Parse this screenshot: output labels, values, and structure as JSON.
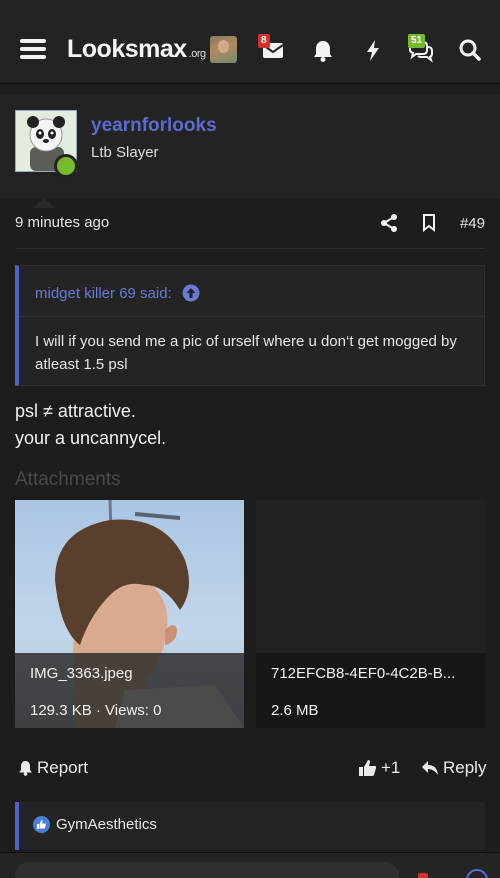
{
  "header": {
    "logo_text": "Looksmax",
    "logo_suffix": ".org",
    "inbox_badge": "8",
    "conversations_badge": "51",
    "icons": [
      "menu-icon",
      "user-avatar",
      "inbox-icon",
      "bell-icon",
      "bolt-icon",
      "chat-bubbles-icon",
      "search-icon"
    ]
  },
  "post": {
    "username": "yearnforlooks",
    "user_title": "Ltb Slayer",
    "time": "9 minutes ago",
    "number": "#49",
    "quote": {
      "author_label": "midget killer 69 said:",
      "text": "I will if you send me a pic of urself where u don‘t get mogged by atleast 1.5 psl"
    },
    "body_line1": "psl ≠ attractive.",
    "body_line2": "your a uncannycel.",
    "attachments_title": "Attachments",
    "attachments": [
      {
        "name": "IMG_3363.jpeg",
        "meta": "129.3 KB · Views: 0"
      },
      {
        "name": "712EFCB8-4EF0-4C2B-B...",
        "meta": "2.6 MB"
      }
    ],
    "actions": {
      "report": "Report",
      "like": "+1",
      "reply": "Reply"
    },
    "reactions": {
      "user": "GymAesthetics"
    }
  },
  "colors": {
    "accent": "#5c6bd0",
    "online": "#79b92e",
    "badge_red": "#d2302a",
    "badge_green": "#77b832"
  }
}
